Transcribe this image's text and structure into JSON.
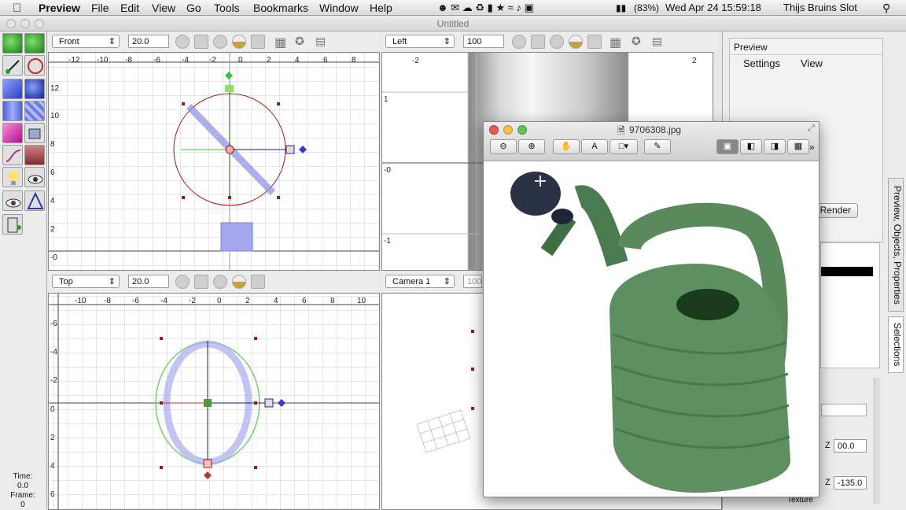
{
  "menubar": {
    "app_name": "Preview",
    "items": [
      "File",
      "Edit",
      "View",
      "Go",
      "Tools",
      "Bookmarks",
      "Window",
      "Help"
    ],
    "battery": "(83%)",
    "clock": "Wed Apr 24  15:59:18",
    "user": "Thijs Bruins Slot"
  },
  "window": {
    "title": "Untitled"
  },
  "toolbox": {
    "time_label": "Time:",
    "time_value": "0.0",
    "frame_label": "Frame:",
    "frame_value": "0"
  },
  "viewports": {
    "front": {
      "view": "Front",
      "zoom": "20.0",
      "xticks": [
        "-12",
        "-10",
        "-8",
        "-6",
        "-4",
        "-2",
        "0",
        "2",
        "4",
        "6",
        "8"
      ],
      "yticks": [
        "12",
        "10",
        "8",
        "6",
        "4",
        "2",
        "-0"
      ]
    },
    "left": {
      "view": "Left",
      "zoom": "100",
      "labels": [
        "-2",
        "2",
        "1",
        "-0",
        "-1"
      ]
    },
    "top": {
      "view": "Top",
      "zoom": "20.0",
      "xticks": [
        "-10",
        "-8",
        "-6",
        "-4",
        "-2",
        "0",
        "2",
        "4",
        "6",
        "8",
        "10"
      ],
      "yticks": [
        "-6",
        "-4",
        "-2",
        "0",
        "2",
        "4",
        "6"
      ]
    },
    "camera": {
      "view": "Camera 1",
      "zoom": "100"
    }
  },
  "right_panel": {
    "title": "Preview",
    "menu_settings": "Settings",
    "menu_view": "View",
    "render_button": "Render",
    "z_label": "Z",
    "z1_value": "00.0",
    "z2_value": "-135.0",
    "texture_label": "Texture",
    "tab_preview": "Preview, Objects, Properties",
    "tab_selections": "Selections"
  },
  "quicklook": {
    "filename": "9706308.jpg"
  },
  "colors": {
    "accent_blue": "#3b62c8",
    "can_green": "#5a8a5c",
    "red_circle": "#a01818"
  }
}
